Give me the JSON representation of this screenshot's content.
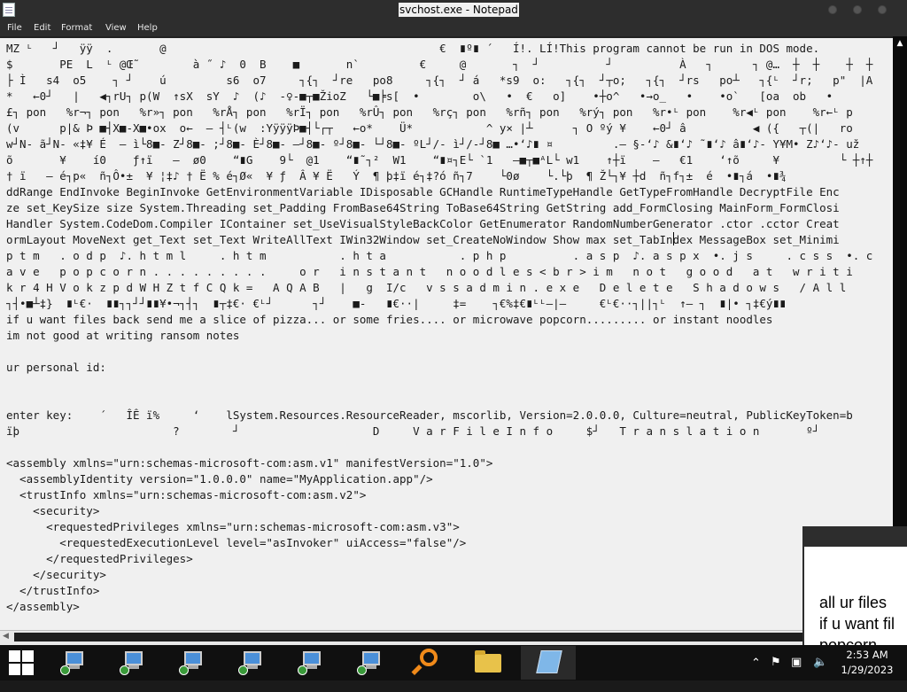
{
  "window": {
    "title": "svchost.exe - Notepad"
  },
  "menu": [
    "File",
    "Edit",
    "Format",
    "View",
    "Help"
  ],
  "editor": {
    "lines": [
      "MZ ᴸ   ┘   ÿÿ  .       @                                         €  ∎º∎ ´   Í!. LÍ!This program cannot be run in DOS mode.",
      "$       PE  L  ᴸ @Œ˜        à ˝ ♪  0  B    ■       n`         €     @       ┐  ┘          ┘          À   ┐      ┐ @…  ┼  ┼    ┼  ┼",
      "├ Ì   s4  o5    ┐ ┘    ú         s6  o7     ┐{┐  ┘re   po8     ┐{┐  ┘ á   *s9  o:   ┐{┐  ┘┬o;   ┐{┐  ┘rs   po┴   ┐{ᴸ  ┘r;   p\"  |A",
      "*   ←0┘   |   ◀┐rU┐ p(W  ↑sX  sY  ♪  (♪  -♀-■┬■ŽioZ   └■╞s[  •        o\\   •  €   o]    •┼o^   •→o_   •    •o`   [oa  ob   •",
      "£┐ pon   %r¬┐ pon   %r»┐ pon   %rÅ┐ pon   %rÏ┐ pon   %rÛ┐ pon   %rç┐ pon   %rñ┐ pon   %rý┐ pon   %r•ᴸ pon    %r◀ᴸ pon    %r←ᴸ p",
      "(v      p|& Þ ■┤X■-X■•ox  o←  – ┤ᴸ(w  :YÿÿÿÞ■┤└┌┬   ←o*    Ü*           ^ y× |┴      ┐ O ºý ¥    ←0┘ â          ◀ ({   ┬(|   ro",
      "w┘N- ã┘N- «‡¥ É  – ì└8■- Z┘8■- ;┘8■- È┘8■- ―┘8■- º┘8■- └┘8■- ºL┘/- ì┘/-┘8■ …•‘♪∎ ¤         .– §-‘♪ &∎‘♪ ˜∎‘♪ â∎‘♪- Y¥M• Z♪‘♪- už",
      "õ       ¥    í0    ƒ↑ï   –  ø0    “∎G    9└  @1    “∎˜┐²  W1    “∎¤┐E└ `1   –■┬■ᴬL└ w1    ↑┼ï    –   €1    ‘↑õ     ¥         └ ┼↑┼",
      "† ï   – é┐p«  ñ┐Ô•±  ¥ ¦‡♪ † Ë % é┐Ø«  ¥ ƒ  Â ¥ Ë   Ý  ¶ þ‡ï é┐‡?ó ñ┐7    └0ø    └.└þ  ¶ Ž└┐¥ ┼d  ñ┐f┐±  é  •∎┐á  •∎¾",
      "ddRange EndInvoke BeginInvoke GetEnvironmentVariable IDisposable GCHandle RuntimeTypeHandle GetTypeFromHandle DecryptFile Enc",
      "ze set_KeySize size System.Threading set_Padding FromBase64String ToBase64String GetString add_FormClosing MainForm_FormClosi",
      "Handler System.CodeDom.Compiler IContainer set_UseVisualStyleBackColor GetEnumerator RandomNumberGenerator .ctor .cctor Creat",
      "ormLayout MoveNext get_Text set_Text WriteAllText IWin32Window set_CreateNoWindow Show max set_TabIndex MessageBox set_Minimi",
      "p t m   . o d p  ♪. h t m l     . h t m           . h t a           . p h p          . a s p  ♪. a s p x  •. j s     . c s s  •. c",
      "a v e   p o p c o r n . . . . . . . . .     o r   i n s t a n t   n o o d l e s < b r > i m   n o t   g o o d   a t   w r i t i",
      "k r 4 H V o k z p d W H Z t f C Q k =   A Q A B   |   g  I/c   v s s a d m i n . e x e   D e l e t e   S h a d o w s   / A l l",
      "┐┤•■┴‡}  ∎ᴸ€·  ∎∎┐┐┘┘∎∎¥•¬┐┤┐  ∎┬‡€· €ᴸ┘      ┐┘    ■-   ∎€··|     ‡=    ┐€%‡€∎ᴸᴸ–|–     €ᴸ€··┐||┐ᴸ  ↑– ┐  ∎|• ┐‡€ý∎∎",
      "if u want files back send me a slice of pizza... or some fries.... or microwave popcorn......... or instant noodles",
      "im not good at writing ransom notes",
      "",
      "ur personal id:",
      "",
      "",
      "enter key:    ´   ÎÊ ï%     ‘    lSystem.Resources.ResourceReader, mscorlib, Version=2.0.0.0, Culture=neutral, PublicKeyToken=b",
      "ïþ                       ?        ┘                    D     V a r F i l e I n f o     $┘   T r a n s l a t i o n       º┘",
      "",
      "<assembly xmlns=\"urn:schemas-microsoft-com:asm.v1\" manifestVersion=\"1.0\">",
      "  <assemblyIdentity version=\"1.0.0.0\" name=\"MyApplication.app\"/>",
      "  <trustInfo xmlns=\"urn:schemas-microsoft-com:asm.v2\">",
      "    <security>",
      "      <requestedPrivileges xmlns=\"urn:schemas-microsoft-com:asm.v3\">",
      "        <requestedExecutionLevel level=\"asInvoker\" uiAccess=\"false\"/>",
      "      </requestedPrivileges>",
      "    </security>",
      "  </trustInfo>",
      "</assembly>"
    ]
  },
  "popup": {
    "lines": [
      "all ur files",
      "if u want fil",
      "popcorn"
    ]
  },
  "taskbar": {
    "items": [
      "pc-icon",
      "pc-icon",
      "pc-icon",
      "pc-icon",
      "pc-icon",
      "pc-icon",
      "search-magnifier-icon",
      "folder-icon",
      "notepad-icon"
    ]
  },
  "clock": {
    "time": "2:53 AM",
    "date": "1/29/2023"
  }
}
